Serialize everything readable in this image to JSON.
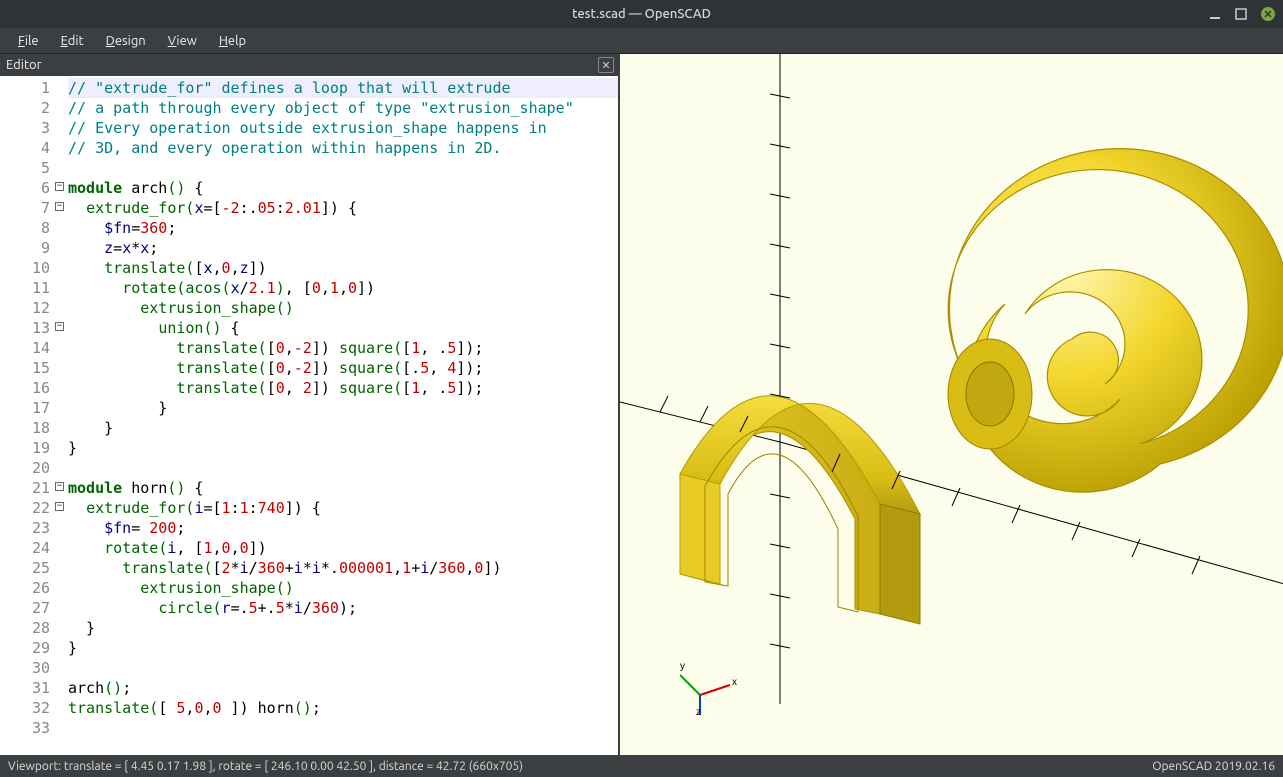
{
  "window": {
    "title": "test.scad — OpenSCAD"
  },
  "menu": {
    "file": "File",
    "edit": "Edit",
    "design": "Design",
    "view": "View",
    "help": "Help"
  },
  "editor": {
    "tab": "Editor",
    "lines": [
      {
        "n": 1,
        "fold": "",
        "hl": true,
        "spans": [
          [
            "c-comment",
            "// \"extrude_for\" defines a loop that will extrude"
          ]
        ]
      },
      {
        "n": 2,
        "fold": "",
        "spans": [
          [
            "c-comment",
            "// a path through every object of type \"extrusion_shape\""
          ]
        ]
      },
      {
        "n": 3,
        "fold": "",
        "spans": [
          [
            "c-comment",
            "// Every operation outside extrusion_shape happens in"
          ]
        ]
      },
      {
        "n": 4,
        "fold": "",
        "spans": [
          [
            "c-comment",
            "// 3D, and every operation within happens in 2D."
          ]
        ]
      },
      {
        "n": 5,
        "fold": "",
        "spans": [
          [
            "",
            ""
          ]
        ]
      },
      {
        "n": 6,
        "fold": "-",
        "spans": [
          [
            "c-kw",
            "module"
          ],
          [
            "",
            " "
          ],
          [
            "c-func",
            "arch"
          ],
          [
            "c-paren",
            "()"
          ],
          [
            "",
            " {"
          ]
        ]
      },
      {
        "n": 7,
        "fold": "-",
        "spans": [
          [
            "",
            "  "
          ],
          [
            "c-builtin",
            "extrude_for"
          ],
          [
            "c-paren",
            "("
          ],
          [
            "c-var",
            "x"
          ],
          [
            "",
            "=["
          ],
          [
            "c-num",
            "-2"
          ],
          [
            "",
            ":."
          ],
          [
            "c-num",
            "05"
          ],
          [
            "",
            ":"
          ],
          [
            "c-num",
            "2.01"
          ],
          [
            "",
            "]) {"
          ]
        ]
      },
      {
        "n": 8,
        "fold": "",
        "spans": [
          [
            "",
            "    "
          ],
          [
            "c-var",
            "$fn"
          ],
          [
            "",
            "="
          ],
          [
            "c-num",
            "360"
          ],
          [
            "",
            ";"
          ]
        ]
      },
      {
        "n": 9,
        "fold": "",
        "spans": [
          [
            "",
            "    "
          ],
          [
            "c-var",
            "z"
          ],
          [
            "",
            "="
          ],
          [
            "c-var",
            "x"
          ],
          [
            "",
            "*"
          ],
          [
            "c-var",
            "x"
          ],
          [
            "",
            ";"
          ]
        ]
      },
      {
        "n": 10,
        "fold": "",
        "spans": [
          [
            "",
            "    "
          ],
          [
            "c-builtin",
            "translate"
          ],
          [
            "c-paren",
            "("
          ],
          [
            "",
            "["
          ],
          [
            "c-var",
            "x"
          ],
          [
            "",
            ","
          ],
          [
            "c-num",
            "0"
          ],
          [
            "",
            ","
          ],
          [
            "c-var",
            "z"
          ],
          [
            "",
            "])"
          ]
        ]
      },
      {
        "n": 11,
        "fold": "",
        "spans": [
          [
            "",
            "      "
          ],
          [
            "c-builtin",
            "rotate"
          ],
          [
            "c-paren",
            "("
          ],
          [
            "c-builtin",
            "acos"
          ],
          [
            "c-paren",
            "("
          ],
          [
            "c-var",
            "x"
          ],
          [
            "",
            "/"
          ],
          [
            "c-num",
            "2.1"
          ],
          [
            "c-paren",
            ")"
          ],
          [
            "",
            ", ["
          ],
          [
            "c-num",
            "0"
          ],
          [
            "",
            ","
          ],
          [
            "c-num",
            "1"
          ],
          [
            "",
            ","
          ],
          [
            "c-num",
            "0"
          ],
          [
            "",
            "])"
          ]
        ]
      },
      {
        "n": 12,
        "fold": "",
        "spans": [
          [
            "",
            "        "
          ],
          [
            "c-builtin",
            "extrusion_shape"
          ],
          [
            "c-paren",
            "()"
          ]
        ]
      },
      {
        "n": 13,
        "fold": "-",
        "spans": [
          [
            "",
            "          "
          ],
          [
            "c-builtin",
            "union"
          ],
          [
            "c-paren",
            "()"
          ],
          [
            "",
            " {"
          ]
        ]
      },
      {
        "n": 14,
        "fold": "",
        "spans": [
          [
            "",
            "            "
          ],
          [
            "c-builtin",
            "translate"
          ],
          [
            "c-paren",
            "("
          ],
          [
            "",
            "["
          ],
          [
            "c-num",
            "0"
          ],
          [
            "",
            ","
          ],
          [
            "c-num",
            "-2"
          ],
          [
            "",
            "]) "
          ],
          [
            "c-builtin",
            "square"
          ],
          [
            "c-paren",
            "("
          ],
          [
            "",
            "["
          ],
          [
            "c-num",
            "1"
          ],
          [
            "",
            ", ."
          ],
          [
            "c-num",
            "5"
          ],
          [
            "",
            "]);"
          ]
        ]
      },
      {
        "n": 15,
        "fold": "",
        "spans": [
          [
            "",
            "            "
          ],
          [
            "c-builtin",
            "translate"
          ],
          [
            "c-paren",
            "("
          ],
          [
            "",
            "["
          ],
          [
            "c-num",
            "0"
          ],
          [
            "",
            ","
          ],
          [
            "c-num",
            "-2"
          ],
          [
            "",
            "]) "
          ],
          [
            "c-builtin",
            "square"
          ],
          [
            "c-paren",
            "("
          ],
          [
            "",
            "[."
          ],
          [
            "c-num",
            "5"
          ],
          [
            "",
            ", "
          ],
          [
            "c-num",
            "4"
          ],
          [
            "",
            "]);"
          ]
        ]
      },
      {
        "n": 16,
        "fold": "",
        "spans": [
          [
            "",
            "            "
          ],
          [
            "c-builtin",
            "translate"
          ],
          [
            "c-paren",
            "("
          ],
          [
            "",
            "["
          ],
          [
            "c-num",
            "0"
          ],
          [
            "",
            ", "
          ],
          [
            "c-num",
            "2"
          ],
          [
            "",
            "]) "
          ],
          [
            "c-builtin",
            "square"
          ],
          [
            "c-paren",
            "("
          ],
          [
            "",
            "["
          ],
          [
            "c-num",
            "1"
          ],
          [
            "",
            ", ."
          ],
          [
            "c-num",
            "5"
          ],
          [
            "",
            "]);"
          ]
        ]
      },
      {
        "n": 17,
        "fold": "",
        "spans": [
          [
            "",
            "          }"
          ]
        ]
      },
      {
        "n": 18,
        "fold": "",
        "spans": [
          [
            "",
            "    }"
          ]
        ]
      },
      {
        "n": 19,
        "fold": "",
        "spans": [
          [
            "",
            "}"
          ]
        ]
      },
      {
        "n": 20,
        "fold": "",
        "spans": [
          [
            "",
            ""
          ]
        ]
      },
      {
        "n": 21,
        "fold": "-",
        "spans": [
          [
            "c-kw",
            "module"
          ],
          [
            "",
            " "
          ],
          [
            "c-func",
            "horn"
          ],
          [
            "c-paren",
            "()"
          ],
          [
            "",
            " {"
          ]
        ]
      },
      {
        "n": 22,
        "fold": "-",
        "spans": [
          [
            "",
            "  "
          ],
          [
            "c-builtin",
            "extrude_for"
          ],
          [
            "c-paren",
            "("
          ],
          [
            "c-var",
            "i"
          ],
          [
            "",
            "=["
          ],
          [
            "c-num",
            "1"
          ],
          [
            "",
            ":"
          ],
          [
            "c-num",
            "1"
          ],
          [
            "",
            ":"
          ],
          [
            "c-num",
            "740"
          ],
          [
            "",
            "]) {"
          ]
        ]
      },
      {
        "n": 23,
        "fold": "",
        "spans": [
          [
            "",
            "    "
          ],
          [
            "c-var",
            "$fn"
          ],
          [
            "",
            "= "
          ],
          [
            "c-num",
            "200"
          ],
          [
            "",
            ";"
          ]
        ]
      },
      {
        "n": 24,
        "fold": "",
        "spans": [
          [
            "",
            "    "
          ],
          [
            "c-builtin",
            "rotate"
          ],
          [
            "c-paren",
            "("
          ],
          [
            "c-var",
            "i"
          ],
          [
            "",
            ", ["
          ],
          [
            "c-num",
            "1"
          ],
          [
            "",
            ","
          ],
          [
            "c-num",
            "0"
          ],
          [
            "",
            ","
          ],
          [
            "c-num",
            "0"
          ],
          [
            "",
            "])"
          ]
        ]
      },
      {
        "n": 25,
        "fold": "",
        "spans": [
          [
            "",
            "      "
          ],
          [
            "c-builtin",
            "translate"
          ],
          [
            "c-paren",
            "("
          ],
          [
            "",
            "["
          ],
          [
            "c-num",
            "2"
          ],
          [
            "",
            "*"
          ],
          [
            "c-var",
            "i"
          ],
          [
            "",
            "/"
          ],
          [
            "c-num",
            "360"
          ],
          [
            "",
            "+"
          ],
          [
            "c-var",
            "i"
          ],
          [
            "",
            "*"
          ],
          [
            "c-var",
            "i"
          ],
          [
            "",
            "*."
          ],
          [
            "c-num",
            "000001"
          ],
          [
            "",
            ","
          ],
          [
            "c-num",
            "1"
          ],
          [
            "",
            "+"
          ],
          [
            "c-var",
            "i"
          ],
          [
            "",
            "/"
          ],
          [
            "c-num",
            "360"
          ],
          [
            "",
            ","
          ],
          [
            "c-num",
            "0"
          ],
          [
            "",
            "])"
          ]
        ]
      },
      {
        "n": 26,
        "fold": "",
        "spans": [
          [
            "",
            "        "
          ],
          [
            "c-builtin",
            "extrusion_shape"
          ],
          [
            "c-paren",
            "()"
          ]
        ]
      },
      {
        "n": 27,
        "fold": "",
        "spans": [
          [
            "",
            "          "
          ],
          [
            "c-builtin",
            "circle"
          ],
          [
            "c-paren",
            "("
          ],
          [
            "c-var",
            "r"
          ],
          [
            "",
            "=."
          ],
          [
            "c-num",
            "5"
          ],
          [
            "",
            "+."
          ],
          [
            "c-num",
            "5"
          ],
          [
            "",
            "*"
          ],
          [
            "c-var",
            "i"
          ],
          [
            "",
            "/"
          ],
          [
            "c-num",
            "360"
          ],
          [
            "",
            ");"
          ]
        ]
      },
      {
        "n": 28,
        "fold": "",
        "spans": [
          [
            "",
            "  }"
          ]
        ]
      },
      {
        "n": 29,
        "fold": "",
        "spans": [
          [
            "",
            "}"
          ]
        ]
      },
      {
        "n": 30,
        "fold": "",
        "spans": [
          [
            "",
            ""
          ]
        ]
      },
      {
        "n": 31,
        "fold": "",
        "spans": [
          [
            "c-func",
            "arch"
          ],
          [
            "c-paren",
            "()"
          ],
          [
            "",
            ";"
          ]
        ]
      },
      {
        "n": 32,
        "fold": "",
        "spans": [
          [
            "c-builtin",
            "translate"
          ],
          [
            "c-paren",
            "("
          ],
          [
            "",
            "[ "
          ],
          [
            "c-num",
            "5"
          ],
          [
            "",
            ","
          ],
          [
            "c-num",
            "0"
          ],
          [
            "",
            ","
          ],
          [
            "c-num",
            "0"
          ],
          [
            "",
            " ]) "
          ],
          [
            "c-func",
            "horn"
          ],
          [
            "c-paren",
            "()"
          ],
          [
            "",
            ";"
          ]
        ]
      },
      {
        "n": 33,
        "fold": "",
        "spans": [
          [
            "",
            ""
          ]
        ]
      }
    ]
  },
  "status": {
    "left": "Viewport: translate = [ 4.45 0.17 1.98 ], rotate = [ 246.10 0.00 42.50 ], distance = 42.72 (660x705)",
    "right": "OpenSCAD 2019.02.16"
  },
  "gizmo": {
    "x": "x",
    "y": "y",
    "z": "z"
  }
}
